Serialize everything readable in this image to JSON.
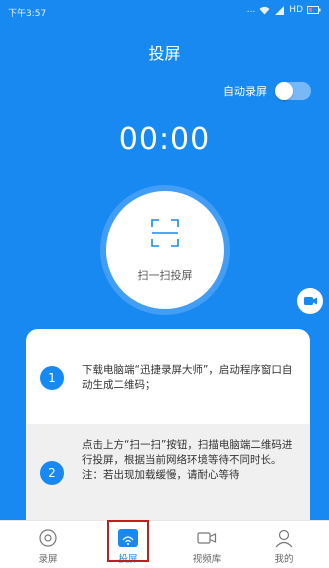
{
  "status_bar": {
    "time": "下午3:57",
    "signal_text": "...",
    "network": "HD"
  },
  "header": {
    "title": "投屏"
  },
  "auto_record": {
    "label": "自动录屏",
    "enabled": false
  },
  "timer": {
    "value": "00:00"
  },
  "scan_button": {
    "label": "扫一扫投屏",
    "icon": "scan-frame-icon"
  },
  "instructions": {
    "steps": [
      {
        "number": "1",
        "text": "下载电脑端“迅捷录屏大师”，启动程序窗口自动生成二维码；"
      },
      {
        "number": "2",
        "text": "点击上方“扫一扫”按钮，扫描电脑端二维码进行投屏，根据当前网络环境等待不同时长。 注：若出现加载缓慢，请耐心等待"
      }
    ]
  },
  "bottom_nav": {
    "items": [
      {
        "label": "录屏",
        "icon": "record-icon"
      },
      {
        "label": "投屏",
        "icon": "cast-icon",
        "active": true
      },
      {
        "label": "视频库",
        "icon": "video-camera-icon"
      },
      {
        "label": "我的",
        "icon": "profile-icon"
      }
    ]
  },
  "colors": {
    "primary": "#1989f2",
    "highlight_border": "#c01e1e"
  }
}
